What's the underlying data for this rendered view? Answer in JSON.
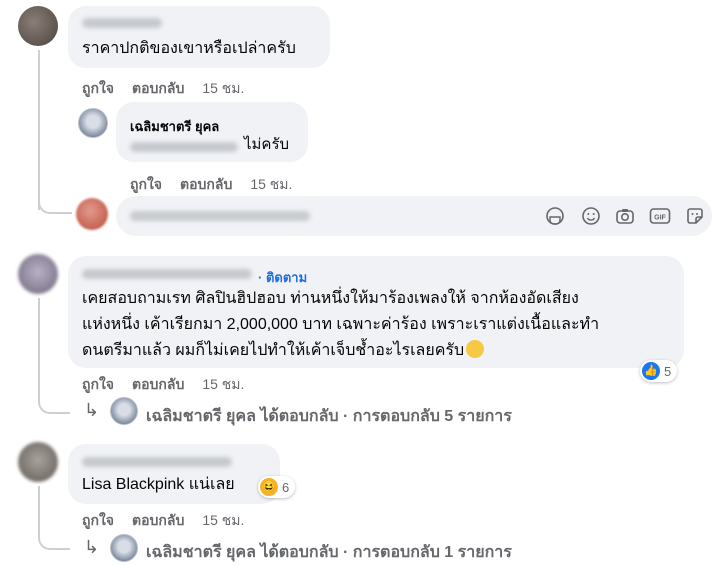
{
  "comments": [
    {
      "text": "ราคาปกติของเขาหรือเปล่าครับ",
      "actions": {
        "like": "ถูกใจ",
        "reply": "ตอบกลับ",
        "time": "15 ชม."
      },
      "reply": {
        "author": "เฉลิมชาตรี ยุคล",
        "text": "ไม่ครับ",
        "actions": {
          "like": "ถูกใจ",
          "reply": "ตอบกลับ",
          "time": "15 ชม."
        }
      }
    },
    {
      "follow": "· ติดตาม",
      "lines": [
        "เคยสอบถามเรท ศิลปินฮิปฮอบ ท่านหนึ่งให้มาร้องเพลงให้ จากห้องอัดเสียง",
        "แห่งหนึ่ง เค้าเรียกมา 2,000,000 บาท เฉพาะค่าร้อง เพราะเราแต่งเนื้อและทำ",
        "ดนตรีมาแล้ว ผมก็ไม่เคยไปทำให้เค้าเจ็บช้ำอะไรเลยครับ"
      ],
      "reaction_count": "5",
      "actions": {
        "like": "ถูกใจ",
        "reply": "ตอบกลับ",
        "time": "15 ชม."
      },
      "replies_summary": "เฉลิมชาตรี ยุคล ได้ตอบกลับ · การตอบกลับ 5 รายการ"
    },
    {
      "text": "Lisa Blackpink แน่เลย",
      "reaction_count": "6",
      "actions": {
        "like": "ถูกใจ",
        "reply": "ตอบกลับ",
        "time": "15 ชม."
      },
      "replies_summary": "เฉลิมชาตรี ยุคล ได้ตอบกลับ · การตอบกลับ 1 รายการ"
    }
  ],
  "composer": {
    "icons": [
      "sticker-icon",
      "emoji-icon",
      "camera-icon",
      "gif-icon",
      "sticker-pack-icon"
    ]
  },
  "colors": {
    "bubble": "#f0f2f5",
    "secondary_text": "#65676b",
    "accent": "#1877f2"
  }
}
